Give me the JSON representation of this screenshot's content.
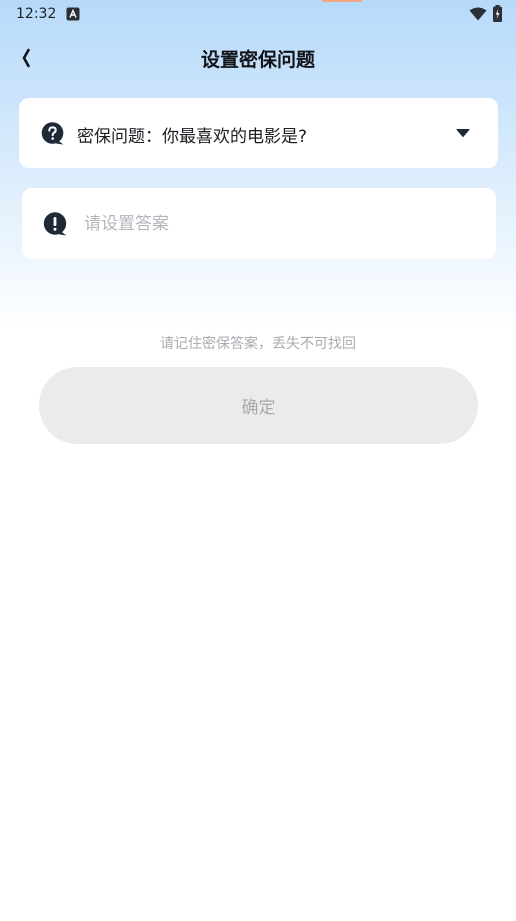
{
  "status_bar": {
    "time": "12:32",
    "app_icon": "notification-app-icon",
    "wifi_icon": "wifi-icon",
    "battery_icon": "battery-charging-icon"
  },
  "header": {
    "back_icon": "chevron-left-icon",
    "title": "设置密保问题"
  },
  "question_field": {
    "icon": "question-bubble-icon",
    "label": "密保问题：你最喜欢的电影是?",
    "dropdown_icon": "caret-down-icon"
  },
  "answer_field": {
    "icon": "exclamation-bubble-icon",
    "value": "",
    "placeholder": "请设置答案"
  },
  "hint": "请记住密保答案，丢失不可找回",
  "confirm_button": {
    "label": "确定",
    "enabled": false
  },
  "colors": {
    "background_top": "#b7dafa",
    "card": "#ffffff",
    "icon_dark": "#1f2937",
    "button_disabled_bg": "#ebebeb",
    "button_disabled_text": "#a9a9a9",
    "hint_text": "#a8abb0"
  }
}
